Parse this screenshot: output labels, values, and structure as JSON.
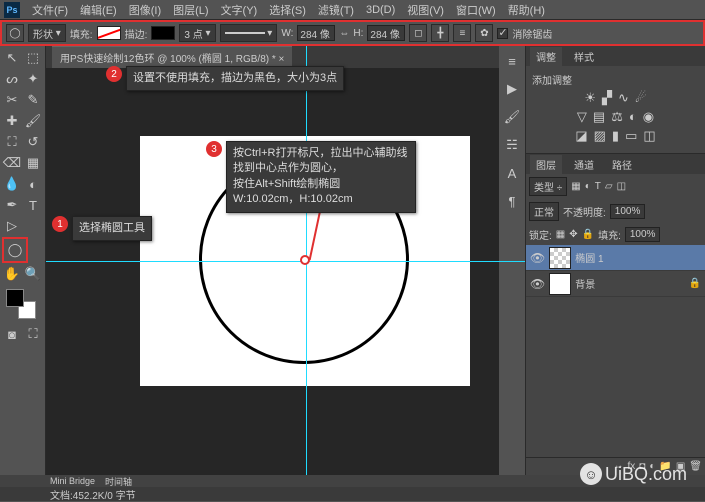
{
  "menus": [
    "文件(F)",
    "编辑(E)",
    "图像(I)",
    "图层(L)",
    "文字(Y)",
    "选择(S)",
    "滤镜(T)",
    "3D(D)",
    "视图(V)",
    "窗口(W)",
    "帮助(H)"
  ],
  "opt": {
    "shape": "形状",
    "fill": "填充:",
    "stroke": "描边:",
    "pts": "3 点",
    "w": "W:",
    "wv": "284 像",
    "h": "H:",
    "hv": "284 像",
    "aa": "消除锯齿"
  },
  "tab": "用PS快速绘制12色环 @ 100% (椭圆 1, RGB/8) * ×",
  "call": {
    "c1": "选择椭圆工具",
    "c2": "设置不使用填充，描边为黑色，大小为3点",
    "c3a": "按Ctrl+R打开标尺，拉出中心辅助线",
    "c3b": "找到中心点作为圆心，",
    "c3c": "按住Alt+Shift绘制椭圆",
    "c3d": "W:10.02cm，H:10.02cm"
  },
  "adj": {
    "tab1": "调整",
    "tab2": "样式",
    "title": "添加调整"
  },
  "lyr": {
    "t1": "图层",
    "t2": "通道",
    "t3": "路径",
    "kind": "类型",
    "mode": "正常",
    "opacity": "不透明度:",
    "opv": "100%",
    "lock": "锁定:",
    "fill": "填充:",
    "fv": "100%",
    "l1": "椭圆 1",
    "l2": "背景"
  },
  "status": "文档:452.2K/0 字节",
  "mini": {
    "a": "Mini Bridge",
    "b": "时间轴"
  },
  "wm": "UiBQ.com",
  "wmicon": "☺"
}
